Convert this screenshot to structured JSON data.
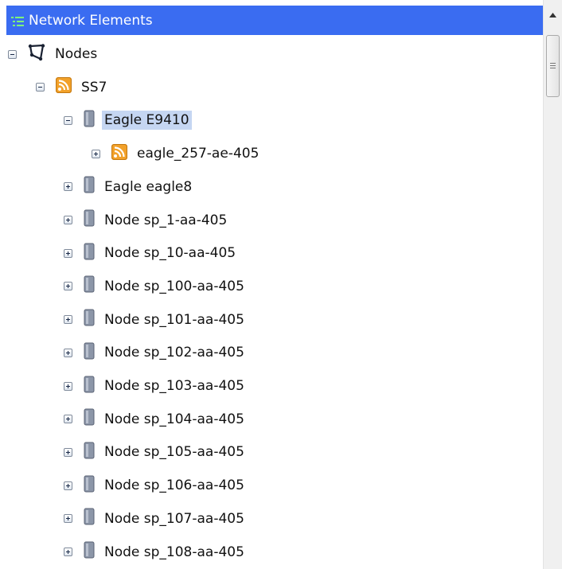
{
  "panel": {
    "title": "Network Elements",
    "header_color": "#3a6cf1"
  },
  "tree": {
    "items": [
      {
        "label": "Nodes",
        "level": 0,
        "expanded": true,
        "icon": "topology-icon",
        "selected": false
      },
      {
        "label": "SS7",
        "level": 1,
        "expanded": true,
        "icon": "rss-feed-icon",
        "selected": false
      },
      {
        "label": "Eagle E9410",
        "level": 2,
        "expanded": true,
        "icon": "server-icon",
        "selected": true
      },
      {
        "label": "eagle_257-ae-405",
        "level": 3,
        "expanded": false,
        "icon": "rss-feed-icon",
        "selected": false
      },
      {
        "label": "Eagle eagle8",
        "level": 2,
        "expanded": false,
        "icon": "server-icon",
        "selected": false
      },
      {
        "label": "Node sp_1-aa-405",
        "level": 2,
        "expanded": false,
        "icon": "server-icon",
        "selected": false
      },
      {
        "label": "Node sp_10-aa-405",
        "level": 2,
        "expanded": false,
        "icon": "server-icon",
        "selected": false
      },
      {
        "label": "Node sp_100-aa-405",
        "level": 2,
        "expanded": false,
        "icon": "server-icon",
        "selected": false
      },
      {
        "label": "Node sp_101-aa-405",
        "level": 2,
        "expanded": false,
        "icon": "server-icon",
        "selected": false
      },
      {
        "label": "Node sp_102-aa-405",
        "level": 2,
        "expanded": false,
        "icon": "server-icon",
        "selected": false
      },
      {
        "label": "Node sp_103-aa-405",
        "level": 2,
        "expanded": false,
        "icon": "server-icon",
        "selected": false
      },
      {
        "label": "Node sp_104-aa-405",
        "level": 2,
        "expanded": false,
        "icon": "server-icon",
        "selected": false
      },
      {
        "label": "Node sp_105-aa-405",
        "level": 2,
        "expanded": false,
        "icon": "server-icon",
        "selected": false
      },
      {
        "label": "Node sp_106-aa-405",
        "level": 2,
        "expanded": false,
        "icon": "server-icon",
        "selected": false
      },
      {
        "label": "Node sp_107-aa-405",
        "level": 2,
        "expanded": false,
        "icon": "server-icon",
        "selected": false
      },
      {
        "label": "Node sp_108-aa-405",
        "level": 2,
        "expanded": false,
        "icon": "server-icon",
        "selected": false
      }
    ]
  },
  "colors": {
    "selection": "#c5d6f2",
    "rss_orange": "#f2a12a",
    "server_gray": "#8c96a8"
  }
}
